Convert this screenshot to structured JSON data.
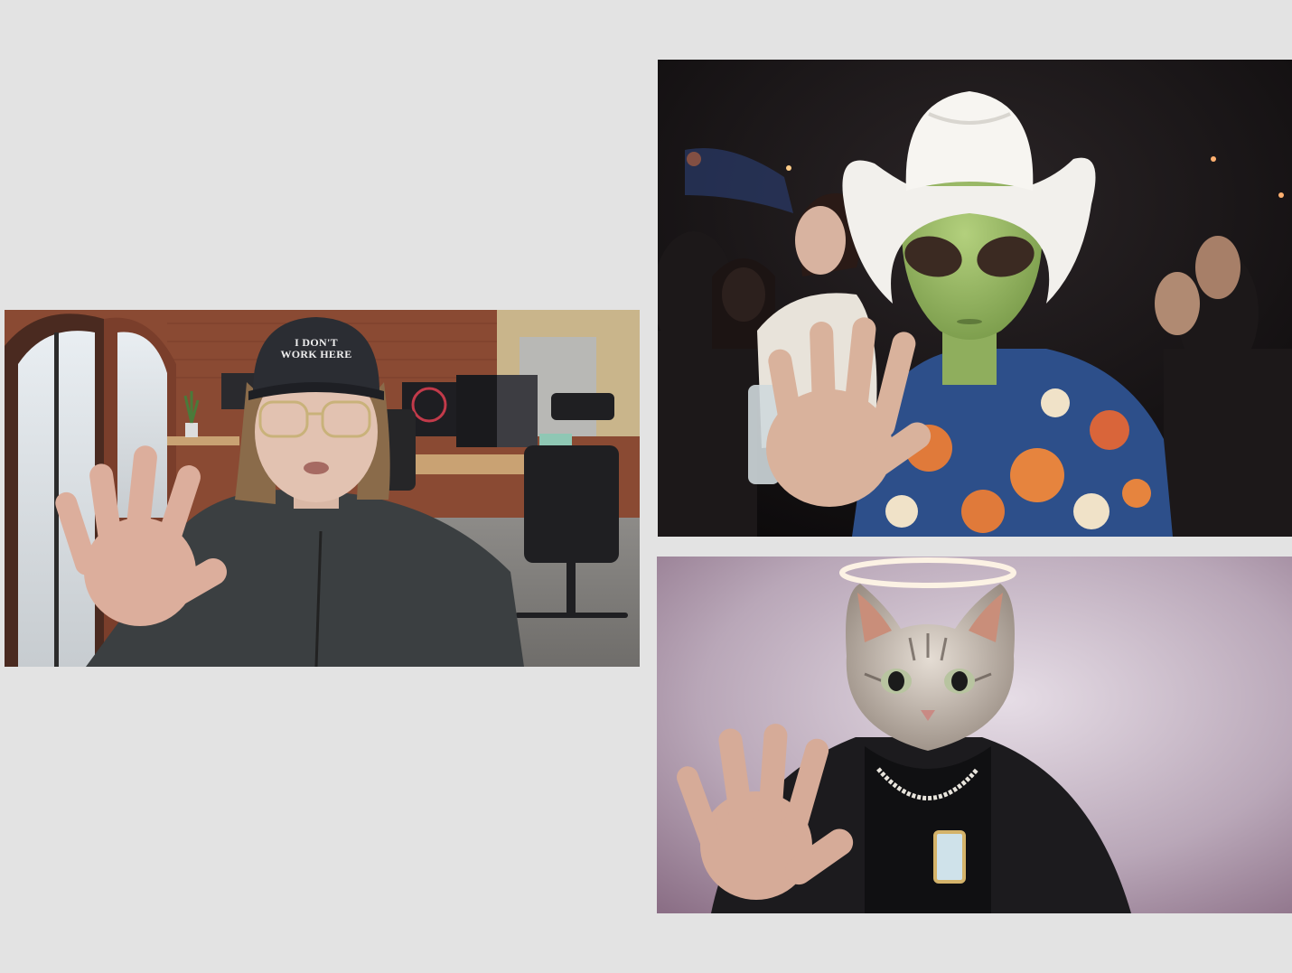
{
  "panels": {
    "office": {
      "hat_text_line1": "I DON'T",
      "hat_text_line2": "WORK HERE"
    }
  },
  "colors": {
    "background": "#e3e3e3",
    "office_wall": "#8a4a33",
    "alien_skin": "#9fbf6a",
    "cat_backdrop": "#b9a7b8"
  }
}
